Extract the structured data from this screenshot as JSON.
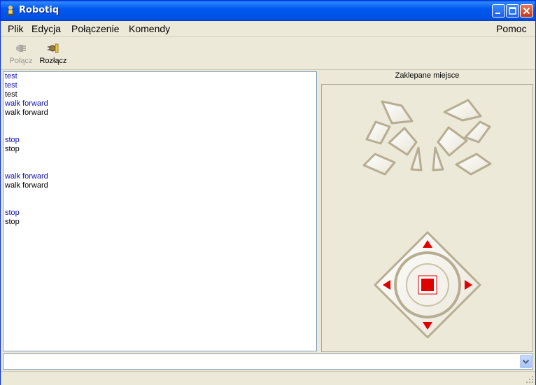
{
  "window": {
    "title": "Robotiq",
    "accent": "#0054e3"
  },
  "menu": {
    "items": [
      "Plik",
      "Edycja",
      "Połączenie",
      "Komendy"
    ],
    "help": "Pomoc"
  },
  "toolbar": {
    "connect": {
      "label": "Połącz",
      "icon": "plug-connect-icon",
      "enabled": false
    },
    "disconnect": {
      "label": "Rozłącz",
      "icon": "plug-disconnect-icon",
      "enabled": true
    }
  },
  "log": {
    "lines": [
      {
        "text": "test",
        "kind": "sent"
      },
      {
        "text": "test",
        "kind": "sent"
      },
      {
        "text": "test",
        "kind": "recv"
      },
      {
        "text": "walk forward",
        "kind": "sent"
      },
      {
        "text": "walk forward",
        "kind": "recv"
      },
      {
        "text": "",
        "kind": "recv"
      },
      {
        "text": "",
        "kind": "recv"
      },
      {
        "text": "stop",
        "kind": "sent"
      },
      {
        "text": "stop",
        "kind": "recv"
      },
      {
        "text": "",
        "kind": "recv"
      },
      {
        "text": "",
        "kind": "recv"
      },
      {
        "text": "walk forward",
        "kind": "sent"
      },
      {
        "text": "walk forward",
        "kind": "recv"
      },
      {
        "text": "",
        "kind": "recv"
      },
      {
        "text": "",
        "kind": "recv"
      },
      {
        "text": "stop",
        "kind": "sent"
      },
      {
        "text": "stop",
        "kind": "recv"
      }
    ],
    "sent_color": "#1010b0",
    "recv_color": "#000000"
  },
  "control_panel": {
    "title": "Zaklepane miejsce",
    "arrow_color": "#e00000",
    "shape_color": "#b6ad92"
  },
  "command_input": {
    "value": ""
  }
}
